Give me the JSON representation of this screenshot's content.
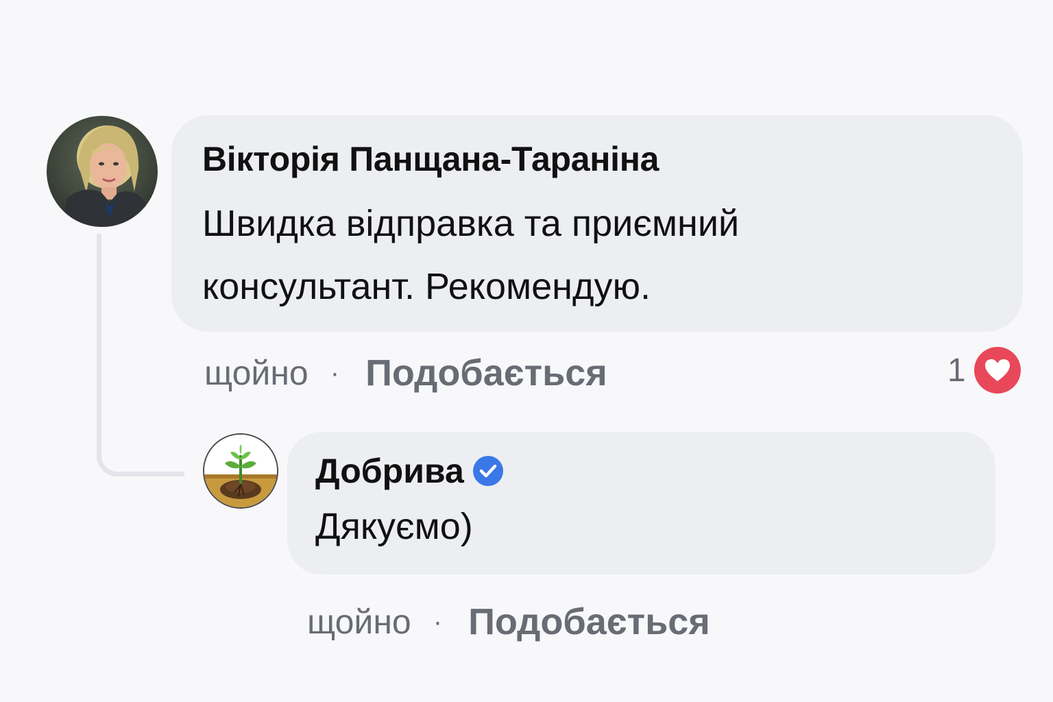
{
  "comments": [
    {
      "author": "Вікторія Панщана-Тараніна",
      "text": "Швидка відправка та приємний консультант. Рекомендую.",
      "time": "щойно",
      "separator": "·",
      "like_label": "Подобається",
      "reactions": {
        "count": "1",
        "type": "heart-icon",
        "color": "#e8485a"
      },
      "avatar": "avatar-photo"
    }
  ],
  "reply": {
    "author": "Добрива",
    "verified": true,
    "verified_color": "#3b78e7",
    "text": "Дякуємо)",
    "time": "щойно",
    "separator": "·",
    "like_label": "Подобається",
    "avatar": "plant-sprout-logo"
  },
  "colors": {
    "background": "#f8f8fa",
    "bubble": "#eceef2",
    "meta_text": "#686c74",
    "thread_line": "#e4e5ea"
  }
}
